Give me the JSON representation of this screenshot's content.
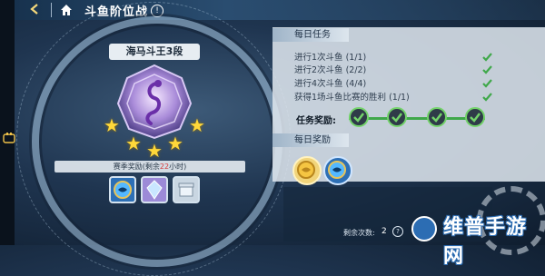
{
  "header": {
    "back_icon": "back-arrow-icon",
    "home_icon": "home-icon",
    "title": "斗鱼阶位战",
    "info_icon": "info-icon"
  },
  "rank": {
    "name": "海马斗王3段",
    "stars_total": 5,
    "stars_filled": 5,
    "badge_icon": "seahorse-rank-badge-icon"
  },
  "season": {
    "label": "赛季奖励",
    "detail_prefix": "(剩余",
    "time": "22",
    "detail_suffix": "小时)"
  },
  "season_rewards": [
    "blue-fish-item-icon",
    "crystal-item-icon",
    "silver-box-item-icon"
  ],
  "daily_tasks": {
    "title": "每日任务",
    "items": [
      {
        "label": "进行1次斗鱼 (1/1)",
        "done": true
      },
      {
        "label": "进行2次斗鱼 (2/2)",
        "done": true
      },
      {
        "label": "进行4次斗鱼 (4/4)",
        "done": true
      },
      {
        "label": "获得1场斗鱼比赛的胜利 (1/1)",
        "done": true
      }
    ],
    "reward_label": "任务奖励:",
    "reward_checks": 4
  },
  "daily_rewards": {
    "title": "每日奖励",
    "items": [
      "gold-coin-icon",
      "blue-fish-coin-icon"
    ]
  },
  "footer": {
    "remain_label": "剩余次数:",
    "remain_value": "2"
  },
  "watermark": "维普手游网",
  "colors": {
    "check_green": "#3fa84a",
    "star_gold": "#ffd83a",
    "accent_red": "#d63b3b"
  }
}
